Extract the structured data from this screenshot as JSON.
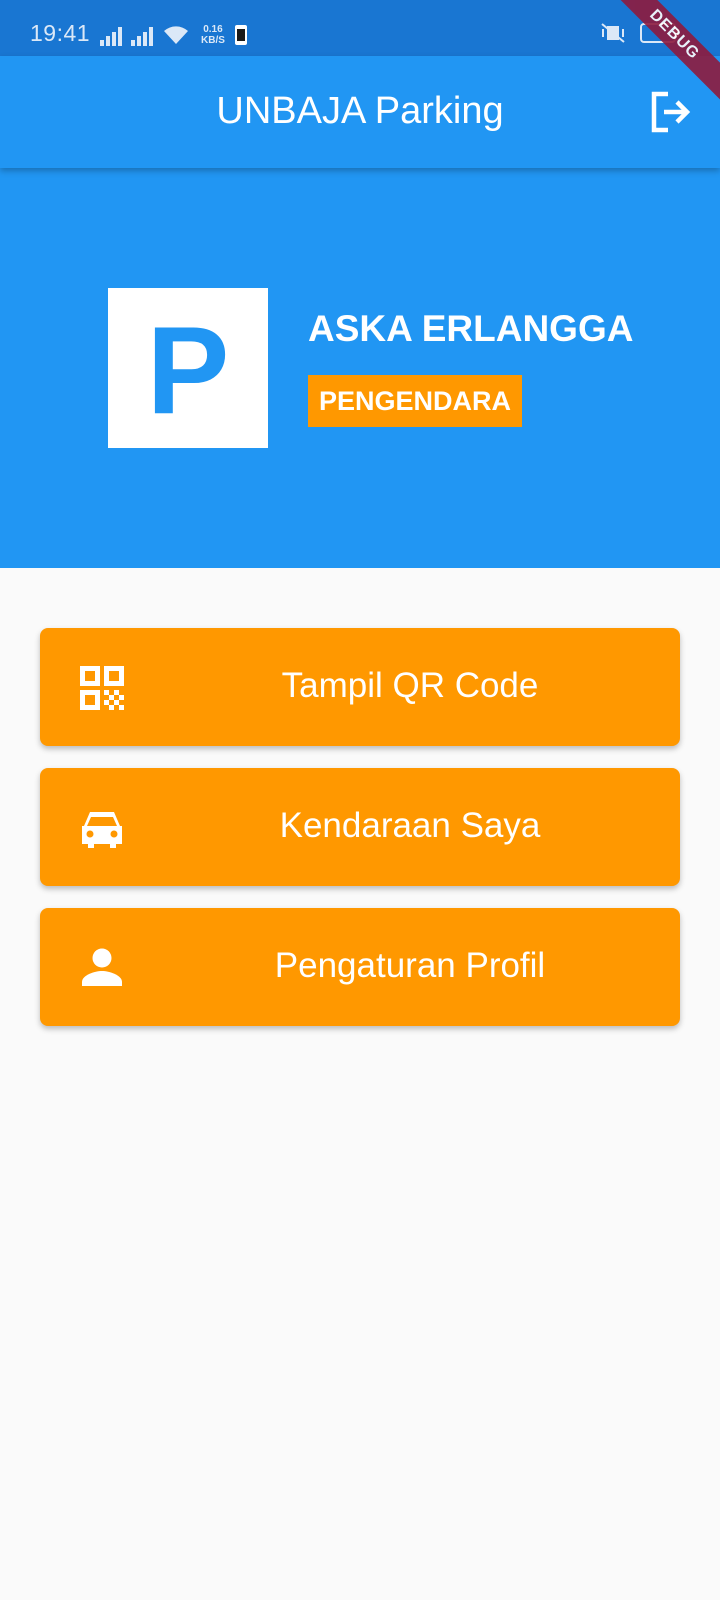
{
  "status_bar": {
    "time": "19:41",
    "speed_value": "0.16",
    "speed_unit": "KB/S"
  },
  "debug_banner": "DEBUG",
  "app_bar": {
    "title": "UNBAJA Parking",
    "logout_icon": "logout-icon"
  },
  "profile": {
    "logo_letter": "P",
    "name": "ASKA ERLANGGA",
    "role": "PENGENDARA"
  },
  "menu": [
    {
      "label": "Tampil QR Code",
      "icon": "qr-code-icon"
    },
    {
      "label": "Kendaraan Saya",
      "icon": "car-icon"
    },
    {
      "label": "Pengaturan Profil",
      "icon": "person-icon"
    }
  ],
  "colors": {
    "status_bar": "#1976d2",
    "primary": "#2196f3",
    "accent": "#ff9800",
    "background": "#fafafa",
    "debug_banner": "#8e1b3e"
  }
}
